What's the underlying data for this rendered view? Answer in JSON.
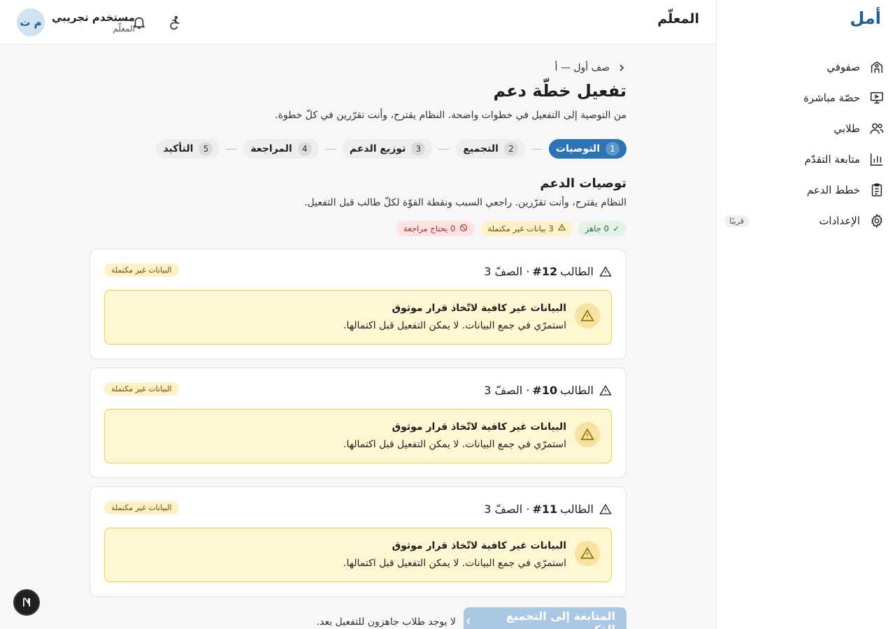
{
  "sidebar": {
    "brand": "أمل",
    "items": [
      {
        "label": "صفوفي",
        "icon": "school-icon"
      },
      {
        "label": "حصّة مباشرة",
        "icon": "presentation-icon"
      },
      {
        "label": "طلابي",
        "icon": "users-icon"
      },
      {
        "label": "متابعة التقدّم",
        "icon": "bar-chart-icon"
      },
      {
        "label": "خطط الدعم",
        "icon": "clipboard-list-icon"
      },
      {
        "label": "الإعدادات",
        "icon": "gear-icon",
        "badge": "قريبًا"
      }
    ]
  },
  "topbar": {
    "title": "المعلّم",
    "user_name": "مستخدم تجريبي",
    "user_role": "المعلّم",
    "avatar_initials": "م ت",
    "icons": [
      "accessibility-icon",
      "bell-icon"
    ]
  },
  "breadcrumb": "صف أول — أ",
  "page": {
    "title": "تفعيل خطّة دعم",
    "subtitle": "من التوصية إلى التفعيل في خطوات واضحة. النظام يقترح، وأنت تقرّرين في كلّ خطوة."
  },
  "steps": [
    {
      "num": "1",
      "label": "التوصيات",
      "active": true
    },
    {
      "num": "2",
      "label": "التجميع"
    },
    {
      "num": "3",
      "label": "توزيع الدعم"
    },
    {
      "num": "4",
      "label": "المراجعة"
    },
    {
      "num": "5",
      "label": "التأكيد"
    }
  ],
  "section": {
    "title": "توصيات الدعم",
    "subtitle": "النظام يقترح، وأنت تقرّرين. راجعي السبب ونقطة القوّة لكلّ طالب قبل التفعيل."
  },
  "pills": {
    "ready": "0 جاهز",
    "incomplete": "3 بيانات غير مكتملة",
    "review": "0 يحتاج مراجعة"
  },
  "cards": [
    {
      "student_prefix": "الطالب",
      "student_num": "#12",
      "grade": "· الصفّ 3",
      "badge": "البيانات غير مكتملة",
      "alert_title": "البيانات غير كافية لاتّخاذ قرار موثوق",
      "alert_desc": "استمرّي في جمع البيانات. لا يمكن التفعيل قبل اكتمالها."
    },
    {
      "student_prefix": "الطالب",
      "student_num": "#10",
      "grade": "· الصفّ 3",
      "badge": "البيانات غير مكتملة",
      "alert_title": "البيانات غير كافية لاتّخاذ قرار موثوق",
      "alert_desc": "استمرّي في جمع البيانات. لا يمكن التفعيل قبل اكتمالها."
    },
    {
      "student_prefix": "الطالب",
      "student_num": "#11",
      "grade": "· الصفّ 3",
      "badge": "البيانات غير مكتملة",
      "alert_title": "البيانات غير كافية لاتّخاذ قرار موثوق",
      "alert_desc": "استمرّي في جمع البيانات. لا يمكن التفعيل قبل اكتمالها."
    }
  ],
  "footer": {
    "next_label": "المتابعة إلى التجميع الذكي",
    "note": "لا يوجد طلاب جاهزون للتفعيل بعد."
  },
  "floating_button": {
    "label": "N"
  },
  "colors": {
    "accent": "#2d74b4",
    "brand": "#1f5f95",
    "warning_bg": "#fff6d2",
    "warning_border": "#f0c94a"
  }
}
